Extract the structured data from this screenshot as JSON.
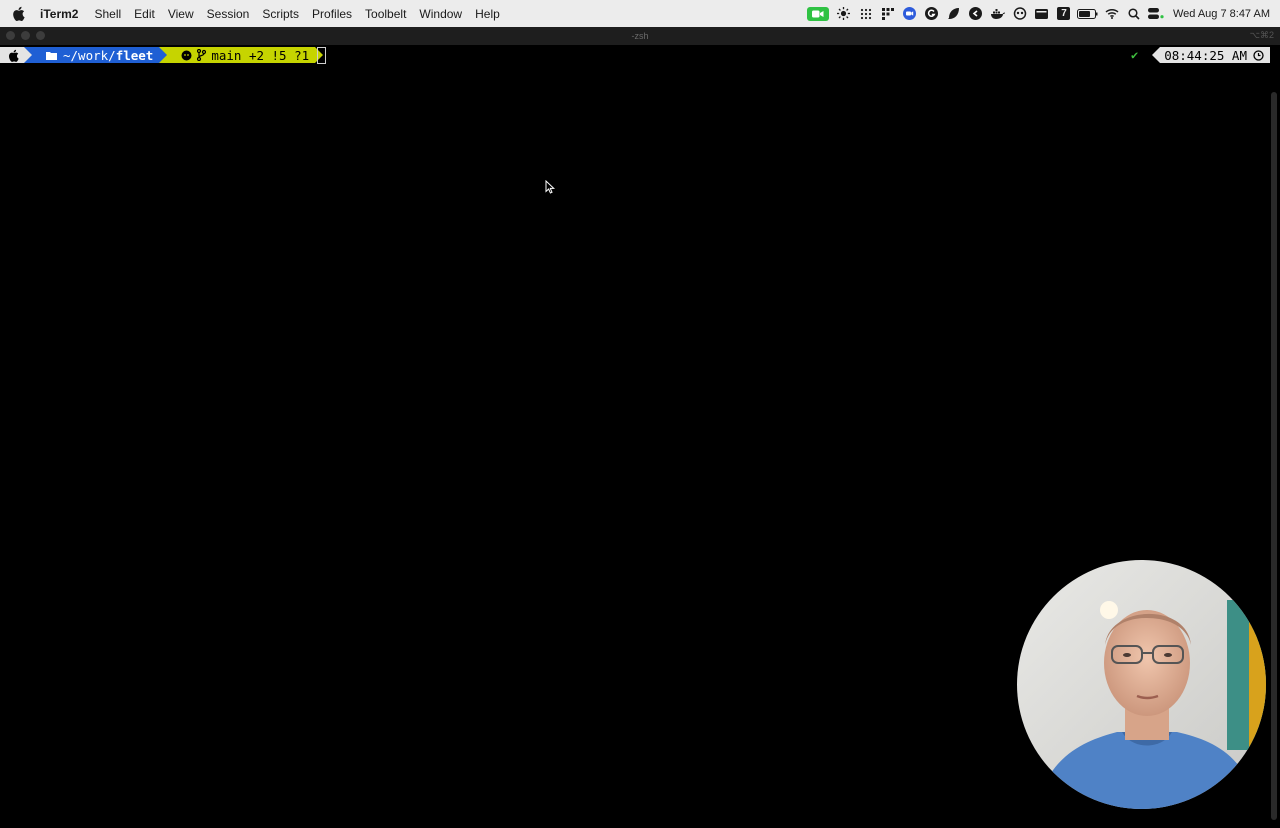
{
  "menubar": {
    "app_name": "iTerm2",
    "items": [
      "Shell",
      "Edit",
      "View",
      "Session",
      "Scripts",
      "Profiles",
      "Toolbelt",
      "Window",
      "Help"
    ],
    "status_icons": [
      "facetime-icon",
      "sun-icon",
      "grid-icon",
      "dots-icon",
      "zoom-icon",
      "grammarly-icon",
      "feather-icon",
      "circle-g-icon",
      "docker-icon",
      "copilot-icon",
      "card-icon",
      "calendar-icon",
      "battery-icon",
      "wifi-icon",
      "search-icon",
      "control-center-icon"
    ],
    "calendar_day": "7",
    "clock": "Wed Aug 7  8:47 AM"
  },
  "window": {
    "title": "-zsh",
    "shortcut": "⌥⌘2"
  },
  "prompt": {
    "path_prefix": "~/work/",
    "path_current": "fleet",
    "git_status": "main +2 !5 ?1",
    "status_check": "✔",
    "time": "08:44:25 AM"
  },
  "colors": {
    "dir_segment": "#1f5fd4",
    "git_segment": "#c6d400",
    "os_segment": "#e4e4e4",
    "terminal_bg": "#000000"
  }
}
